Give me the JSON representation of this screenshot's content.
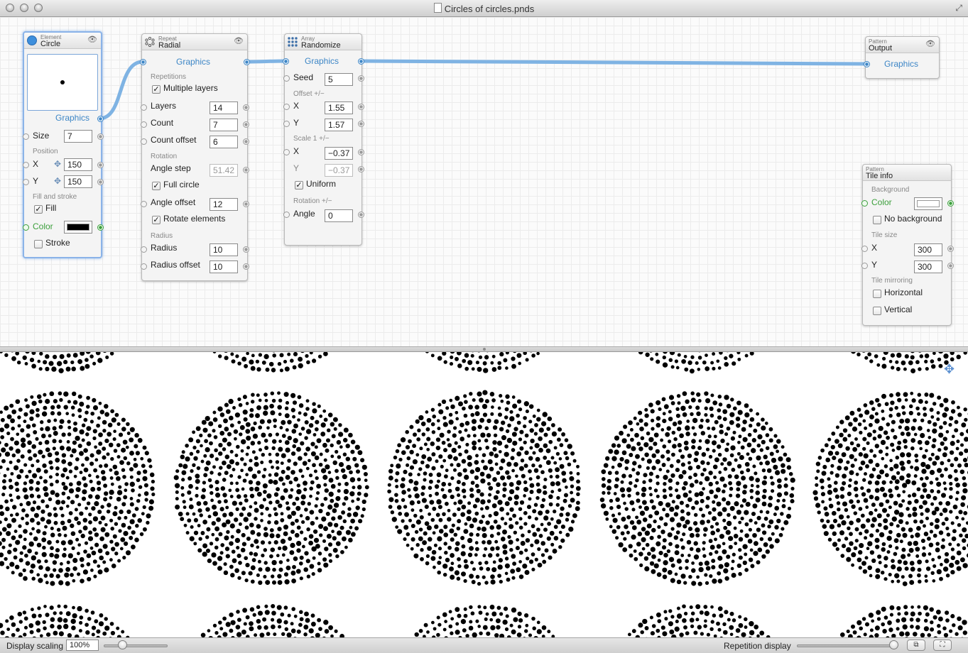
{
  "window": {
    "title": "Circles of circles.pnds"
  },
  "nodes": {
    "circle": {
      "category": "Element",
      "name": "Circle",
      "output_label": "Graphics",
      "size_label": "Size",
      "size_value": "7",
      "position_section": "Position",
      "x_label": "X",
      "x_value": "150",
      "y_label": "Y",
      "y_value": "150",
      "fill_section": "Fill and stroke",
      "fill_label": "Fill",
      "fill_checked": true,
      "color_label": "Color",
      "color_value": "#000000",
      "stroke_label": "Stroke",
      "stroke_checked": false
    },
    "radial": {
      "category": "Repeat",
      "name": "Radial",
      "graphics_label": "Graphics",
      "repetitions_section": "Repetitions",
      "multiple_layers_label": "Multiple layers",
      "multiple_layers_checked": true,
      "layers_label": "Layers",
      "layers_value": "14",
      "count_label": "Count",
      "count_value": "7",
      "count_offset_label": "Count offset",
      "count_offset_value": "6",
      "rotation_section": "Rotation",
      "angle_step_label": "Angle step",
      "angle_step_value": "51.42",
      "full_circle_label": "Full circle",
      "full_circle_checked": true,
      "angle_offset_label": "Angle offset",
      "angle_offset_value": "12",
      "rotate_elements_label": "Rotate elements",
      "rotate_elements_checked": true,
      "radius_section": "Radius",
      "radius_label": "Radius",
      "radius_value": "10",
      "radius_offset_label": "Radius offset",
      "radius_offset_value": "10"
    },
    "randomize": {
      "category": "Array",
      "name": "Randomize",
      "graphics_label": "Graphics",
      "seed_label": "Seed",
      "seed_value": "5",
      "offset_section": "Offset +/−",
      "offset_x_label": "X",
      "offset_x_value": "1.55",
      "offset_y_label": "Y",
      "offset_y_value": "1.57",
      "scale_section": "Scale 1 +/−",
      "scale_x_label": "X",
      "scale_x_value": "−0.37",
      "scale_y_label": "Y",
      "scale_y_value": "−0.37",
      "uniform_label": "Uniform",
      "uniform_checked": true,
      "rotation_section": "Rotation +/−",
      "angle_label": "Angle",
      "angle_value": "0"
    },
    "output": {
      "category": "Pattern",
      "name": "Output",
      "graphics_label": "Graphics"
    },
    "tile_info": {
      "category": "Pattern",
      "name": "Tile info",
      "background_section": "Background",
      "color_label": "Color",
      "color_value": "#ffffff",
      "no_background_label": "No background",
      "no_background_checked": false,
      "tile_size_section": "Tile size",
      "x_label": "X",
      "x_value": "300",
      "y_label": "Y",
      "y_value": "300",
      "mirroring_section": "Tile mirroring",
      "horizontal_label": "Horizontal",
      "horizontal_checked": false,
      "vertical_label": "Vertical",
      "vertical_checked": false
    }
  },
  "statusbar": {
    "display_scaling_label": "Display scaling",
    "display_scaling_value": "100%",
    "repetition_display_label": "Repetition display"
  },
  "icons": {
    "eye": "eye-icon",
    "move": "move-icon",
    "document": "document-icon",
    "fullscreen": "fullscreen-icon"
  },
  "colors": {
    "port_blue": "#3d86c6",
    "port_green": "#3c9f3c",
    "selection": "#8ab3e8"
  }
}
